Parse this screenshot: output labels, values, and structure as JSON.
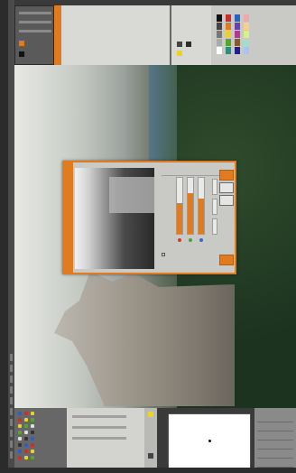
{
  "app": {
    "title": ""
  },
  "menu": {
    "items": [
      "",
      "",
      "",
      "",
      "",
      "",
      "",
      "",
      "",
      ""
    ]
  },
  "dialog": {
    "title": "",
    "ok_label": "",
    "cancel_label": "",
    "help_label": "",
    "reset_label": "",
    "preview_label": "",
    "channels": [
      {
        "label": "",
        "color": "#d13a2f",
        "value": 0.55
      },
      {
        "label": "",
        "color": "#48a23f",
        "value": 0.72
      },
      {
        "label": "",
        "color": "#3f66c9",
        "value": 0.63
      }
    ]
  },
  "palette": {
    "colors": [
      "#111111",
      "#444444",
      "#777777",
      "#aaaaaa",
      "#ffffff",
      "#c9302c",
      "#e07b1f",
      "#e8d22c",
      "#55a630",
      "#2d8f7b",
      "#2f5fbf",
      "#6a3fb5",
      "#b03a8c",
      "#8b5a2b",
      "#1f1f8f",
      "#f0a8a8",
      "#f7d08a",
      "#d8f08a",
      "#9fe0c8",
      "#a8c4f0"
    ]
  },
  "layers": {
    "items": [
      "",
      "",
      "",
      "",
      "",
      ""
    ]
  },
  "colors": {
    "accent": "#e07b1f",
    "panel": "#d9dad6",
    "dark": "#2b2b2b"
  }
}
